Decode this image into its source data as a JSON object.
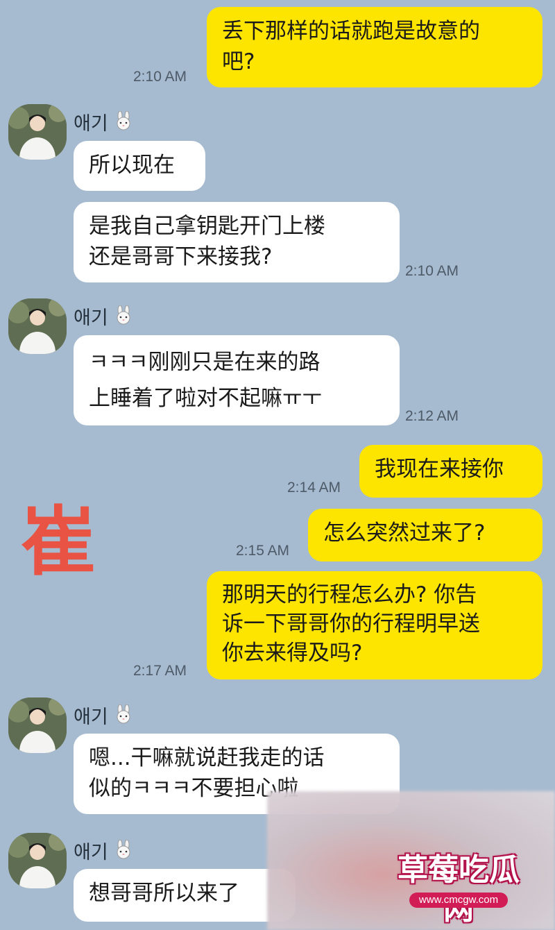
{
  "contact_name": "애기",
  "messages": [
    {
      "side": "me",
      "text": "丢下那样的话就跑是故意的\n吧?",
      "time": "2:10 AM"
    },
    {
      "side": "them",
      "text": "所以现在",
      "time": ""
    },
    {
      "side": "them",
      "text": "是我自己拿钥匙开门上楼\n还是哥哥下来接我?",
      "time": "2:10 AM"
    },
    {
      "side": "them",
      "text": "ㅋㅋㅋ刚刚只是在来的路\n上睡着了啦对不起嘛ㅠㅜ",
      "time": "2:12 AM"
    },
    {
      "side": "me",
      "text": "我现在来接你",
      "time": "2:14 AM"
    },
    {
      "side": "me",
      "text": "怎么突然过来了?",
      "time": "2:15 AM"
    },
    {
      "side": "me",
      "text": "那明天的行程怎么办? 你告\n诉一下哥哥你的行程明早送\n你去来得及吗?",
      "time": "2:17 AM"
    },
    {
      "side": "them",
      "text": "嗯...干嘛就说赶我走的话\n似的ㅋㅋㅋ不要担心啦",
      "time": ""
    },
    {
      "side": "them",
      "text": "想哥哥所以来了",
      "time": ""
    }
  ],
  "overlay": {
    "side_char": "崔",
    "logo_text": "草莓吃瓜网",
    "logo_url": "www.cmcgw.com"
  },
  "colors": {
    "background": "#a7bbd0",
    "my_bubble": "#fee500",
    "their_bubble": "#ffffff",
    "side_char": "#e85343",
    "logo_accent": "#d21c55"
  }
}
